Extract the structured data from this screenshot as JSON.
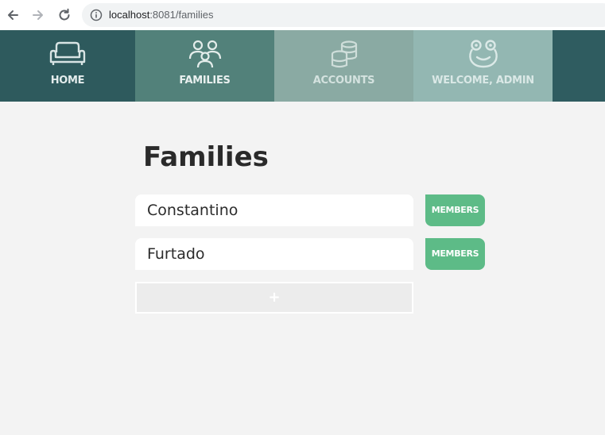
{
  "browser": {
    "url_host": "localhost",
    "url_path": ":8081/families"
  },
  "nav": {
    "tabs": [
      {
        "label": "HOME",
        "icon": "sofa-icon"
      },
      {
        "label": "FAMILIES",
        "icon": "people-icon"
      },
      {
        "label": "ACCOUNTS",
        "icon": "coins-icon"
      },
      {
        "label": "WELCOME, ADMIN",
        "icon": "frog-icon"
      }
    ],
    "active_tab": "FAMILIES"
  },
  "main": {
    "title": "Families",
    "families": [
      {
        "name": "Constantino",
        "button_label": "MEMBERS"
      },
      {
        "name": "Furtado",
        "button_label": "MEMBERS"
      }
    ],
    "add_label": "+"
  },
  "colors": {
    "nav_bg": "#2f5c60",
    "tab_home": "#2e5a5d",
    "tab_families": "#52817a",
    "tab_accounts": "#8aaaa3",
    "tab_welcome": "#93b7b2",
    "members_button": "#5dbb87",
    "page_bg": "#f3f3f3"
  }
}
